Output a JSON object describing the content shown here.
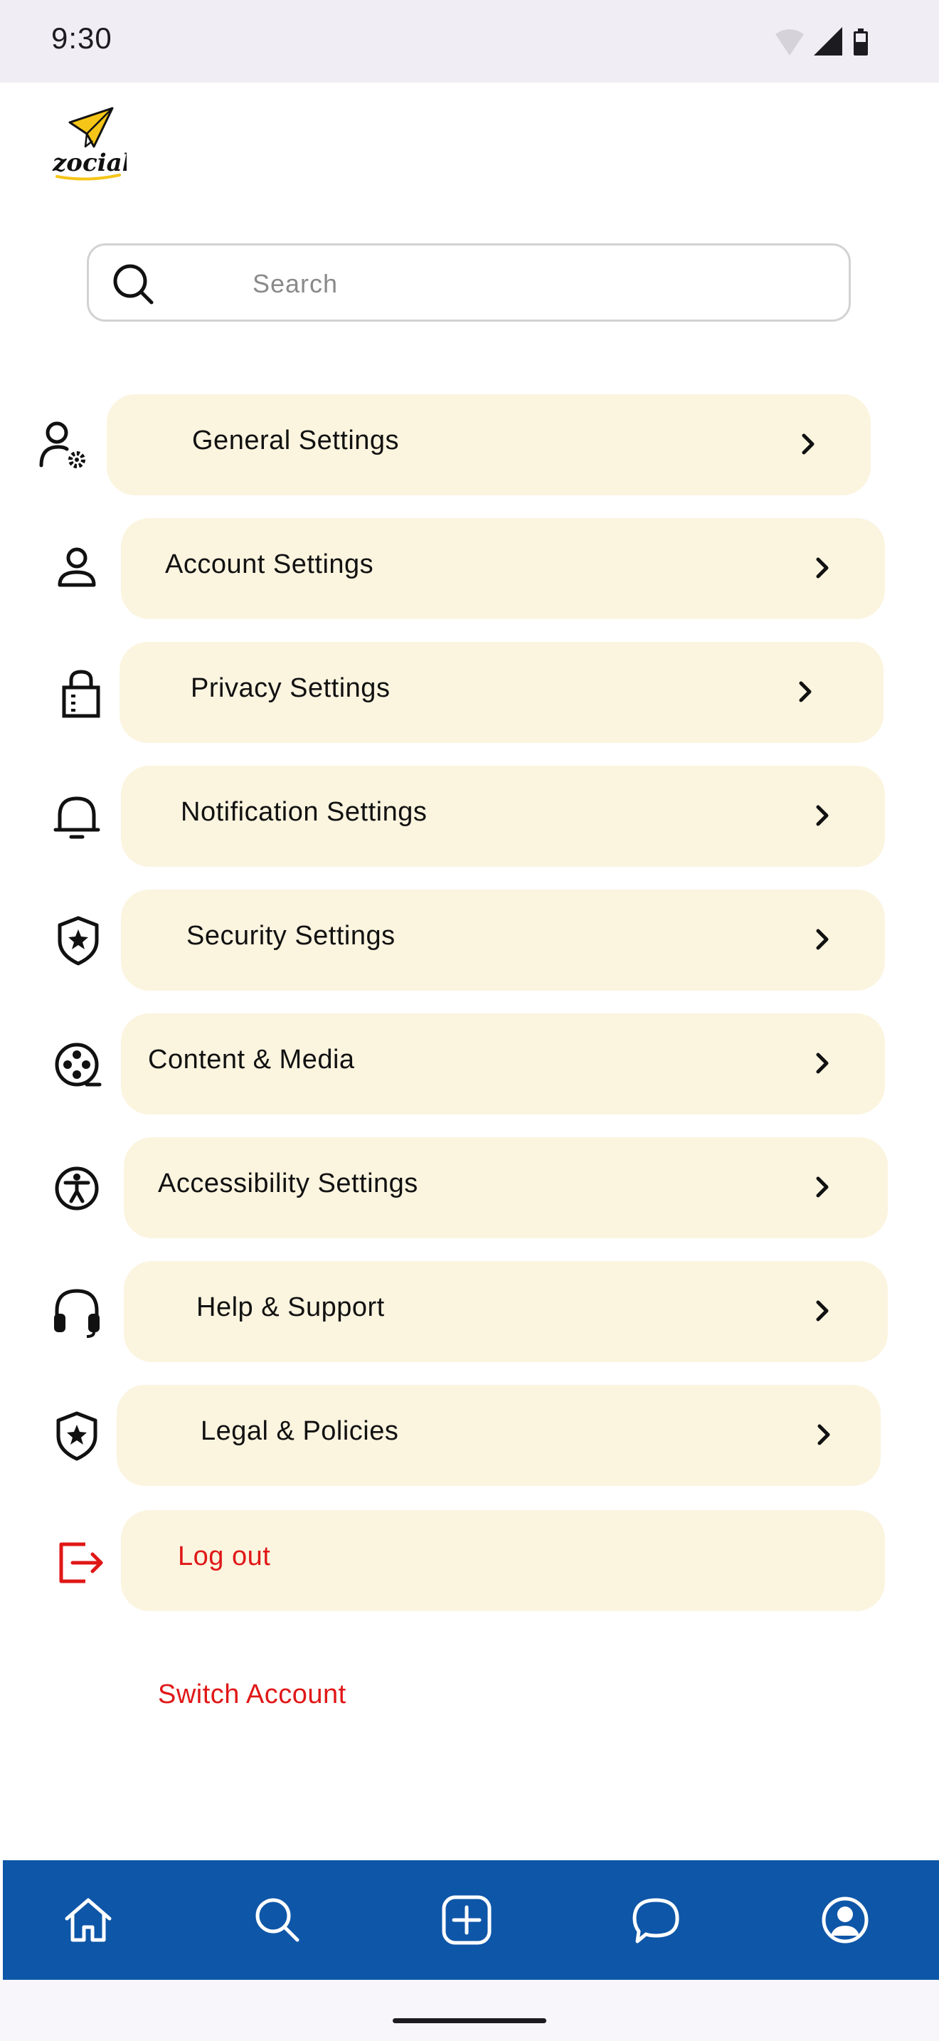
{
  "status_bar": {
    "time": "9:30",
    "icons": [
      "wifi-icon",
      "cellular-icon",
      "battery-icon"
    ]
  },
  "app": {
    "logo_text": "zocial"
  },
  "search": {
    "placeholder": "Search",
    "value": ""
  },
  "menu": {
    "items": [
      {
        "label": "General Settings",
        "icon": "user-gear-icon"
      },
      {
        "label": "Account Settings",
        "icon": "user-icon"
      },
      {
        "label": "Privacy Settings",
        "icon": "lock-icon"
      },
      {
        "label": "Notification Settings",
        "icon": "bell-icon"
      },
      {
        "label": "Security Settings",
        "icon": "shield-star-icon"
      },
      {
        "label": "Content & Media",
        "icon": "film-reel-icon"
      },
      {
        "label": "Accessibility Settings",
        "icon": "accessibility-icon"
      },
      {
        "label": "Help & Support",
        "icon": "headset-icon"
      },
      {
        "label": "Legal & Policies",
        "icon": "shield-star-icon"
      },
      {
        "label": "Log out",
        "icon": "logout-icon"
      }
    ],
    "switch_account": "Switch Account"
  },
  "bottom_nav": {
    "items": [
      "home-icon",
      "search-icon",
      "add-post-icon",
      "chat-icon",
      "profile-icon"
    ]
  },
  "colors": {
    "item_background": "#fbf4df",
    "nav_background": "#0e56a8",
    "danger": "#e01717",
    "status_bar_background": "#f1edf5"
  }
}
